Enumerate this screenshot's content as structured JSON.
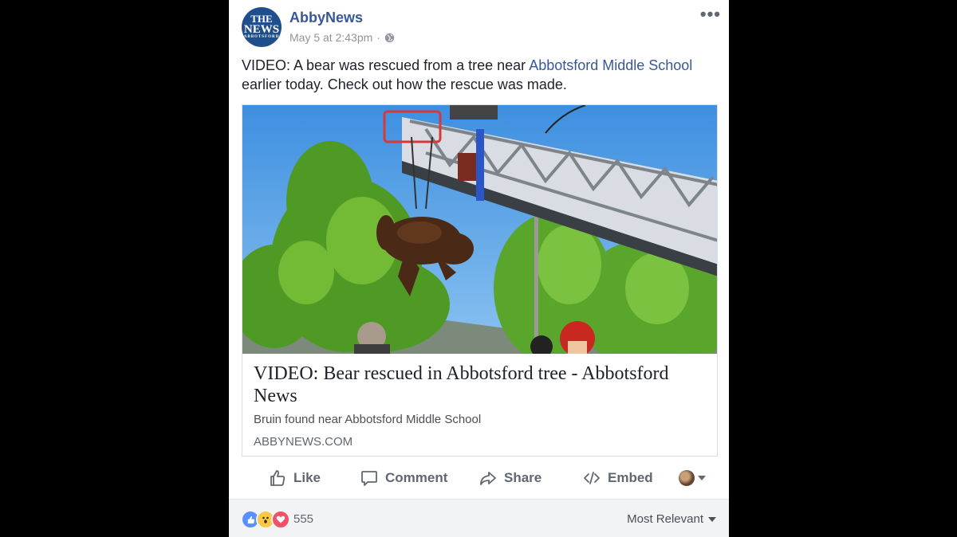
{
  "post": {
    "page_name": "AbbyNews",
    "avatar_text": {
      "line1": "THE",
      "line2": "NEWS",
      "line3": "ABBOTSFORD"
    },
    "timestamp": "May 5 at 2:43pm",
    "separator": "·",
    "privacy_icon": "globe-icon",
    "more_icon": "more-options-icon",
    "text_before_link": "VIDEO: A bear was rescued from a tree near ",
    "text_link": "Abbotsford Middle School",
    "text_after_link": " earlier today. Check out how the rescue was made."
  },
  "link_card": {
    "image_alt": "Bear hanging from a fire truck ladder among green trees",
    "title": "VIDEO: Bear rescued in Abbotsford tree - Abbotsford News",
    "description": "Bruin found near Abbotsford Middle School",
    "domain": "ABBYNEWS.COM"
  },
  "actions": {
    "like": "Like",
    "comment": "Comment",
    "share": "Share",
    "embed": "Embed",
    "icons": [
      "thumbs-up-icon",
      "comment-icon",
      "share-icon",
      "code-icon",
      "chevron-down-icon"
    ]
  },
  "reactions": {
    "types": [
      "like",
      "wow",
      "love"
    ],
    "count": "555",
    "sort_label": "Most Relevant"
  },
  "colors": {
    "link": "#365899",
    "text": "#1d2129",
    "muted": "#90949c",
    "action": "#606770",
    "footer_bg": "#f2f3f5"
  }
}
